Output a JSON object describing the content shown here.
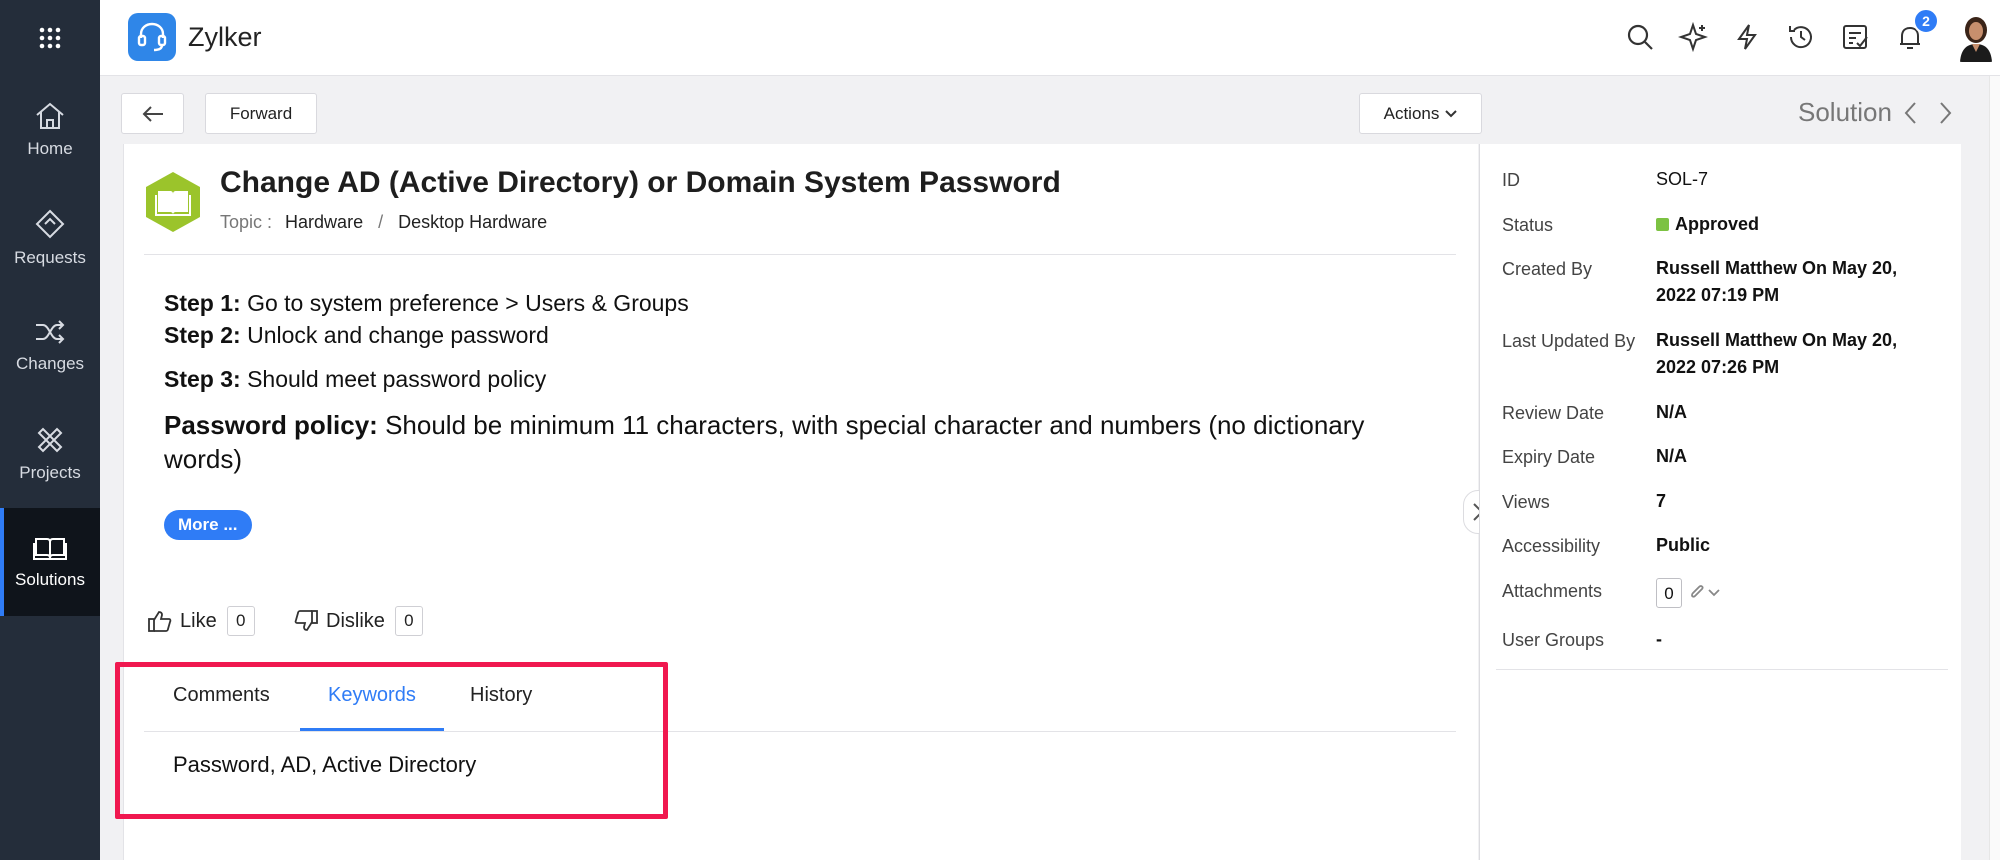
{
  "app": {
    "name": "Zylker"
  },
  "nav": {
    "items": [
      {
        "label": "Home",
        "icon": "home-icon"
      },
      {
        "label": "Requests",
        "icon": "requests-icon"
      },
      {
        "label": "Changes",
        "icon": "changes-icon"
      },
      {
        "label": "Projects",
        "icon": "projects-icon"
      },
      {
        "label": "Solutions",
        "icon": "solutions-icon",
        "active": true
      }
    ]
  },
  "topbar": {
    "notification_count": "2"
  },
  "toolbar": {
    "forward_label": "Forward",
    "actions_label": "Actions",
    "section_title": "Solution"
  },
  "solution": {
    "title": "Change AD (Active Directory) or Domain System Password",
    "topic_label": "Topic :",
    "topic_path": [
      "Hardware",
      "Desktop Hardware"
    ],
    "steps": [
      {
        "label": "Step 1:",
        "text": "Go to system preference > Users & Groups"
      },
      {
        "label": "Step 2:",
        "text": "Unlock and change password"
      },
      {
        "label": "Step 3:",
        "text": "Should meet password policy"
      }
    ],
    "policy_label": "Password policy:",
    "policy_text": "Should be minimum 11 characters, with special character and numbers (no dictionary words)",
    "more_label": "More ...",
    "like_label": "Like",
    "like_count": "0",
    "dislike_label": "Dislike",
    "dislike_count": "0"
  },
  "tabs": [
    {
      "label": "Comments"
    },
    {
      "label": "Keywords",
      "active": true
    },
    {
      "label": "History"
    }
  ],
  "keywords": "Password, AD, Active Directory",
  "properties": {
    "id": {
      "label": "ID",
      "value": "SOL-7"
    },
    "status": {
      "label": "Status",
      "value": "Approved"
    },
    "created_by": {
      "label": "Created By",
      "value": "Russell Matthew On May 20, 2022 07:19 PM"
    },
    "last_updated_by": {
      "label": "Last Updated By",
      "value": "Russell Matthew On May 20, 2022 07:26 PM"
    },
    "review_date": {
      "label": "Review Date",
      "value": "N/A"
    },
    "expiry_date": {
      "label": "Expiry Date",
      "value": "N/A"
    },
    "views": {
      "label": "Views",
      "value": "7"
    },
    "accessibility": {
      "label": "Accessibility",
      "value": "Public"
    },
    "attachments": {
      "label": "Attachments",
      "value": "0"
    },
    "user_groups": {
      "label": "User Groups",
      "value": "-"
    }
  },
  "colors": {
    "accent": "#2f7cf6",
    "sidebar": "#242d3a",
    "highlight": "#f0184f",
    "status_approved": "#7cc242",
    "solution_icon": "#9bc42b"
  }
}
